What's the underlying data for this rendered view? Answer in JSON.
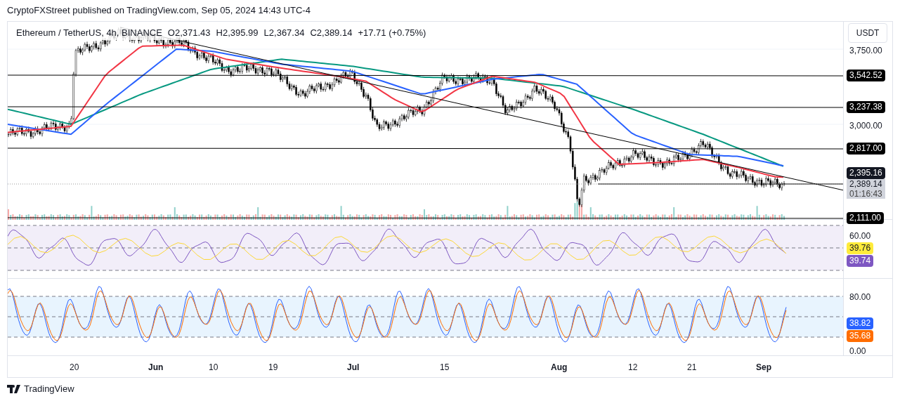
{
  "header": {
    "text": "CryptoFXStreet published on TradingView.com, Sep 05, 2024 14:43 UTC-4"
  },
  "price_pane": {
    "symbol": "Ethereum / TetherUS, 4h, BINANCE",
    "ohlc": [
      "O2,371.43",
      "H2,395.99",
      "L2,367.34",
      "C2,389.14",
      "+17.71 (+0.75%)"
    ],
    "currency_button": "USDT",
    "axis_labels": [
      "3,750.00",
      "3,000.00"
    ],
    "levels": [
      {
        "label": "3,542.52"
      },
      {
        "label": "3,237.38"
      },
      {
        "label": "2,817.00"
      },
      {
        "label": "2,111.00"
      }
    ],
    "ma_badge": "2,395.16",
    "last_price": "2,389.14",
    "countdown": "01:16:43"
  },
  "rsi_pane": {
    "axis_labels": [
      "60.00"
    ],
    "badges": [
      {
        "label": "39.76",
        "color": "#ffeb3b"
      },
      {
        "label": "39.74",
        "color": "#7e57c2"
      }
    ]
  },
  "stoch_pane": {
    "axis_labels": [
      "80.00",
      "0.00"
    ],
    "badges": [
      {
        "label": "38.82",
        "color": "#2962ff"
      },
      {
        "label": "35.68",
        "color": "#ff6d00"
      }
    ]
  },
  "time_axis": [
    "20",
    "Jun",
    "10",
    "19",
    "Jul",
    "15",
    "Aug",
    "12",
    "21",
    "Sep"
  ],
  "footer": {
    "brand": "TradingView"
  }
}
